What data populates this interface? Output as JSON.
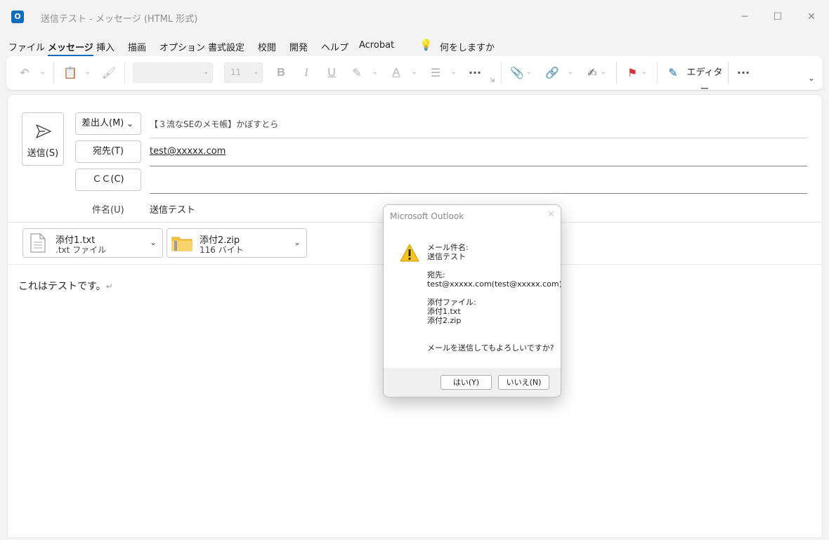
{
  "window": {
    "app_icon": "outlook-icon",
    "title": "送信テスト  -  メッセージ (HTML 形式)"
  },
  "menu": [
    "ファイル",
    "メッセージ",
    "挿入",
    "描画",
    "オプション",
    "書式設定",
    "校閲",
    "開発",
    "ヘルプ",
    "Acrobat"
  ],
  "menu_search": "何をしますか",
  "ribbon": {
    "font_size": "11",
    "bold": "B",
    "italic": "I",
    "underline": "U",
    "font_color": "A",
    "editor_label": "エディター"
  },
  "compose": {
    "send_label": "送信(S)",
    "from_button": "差出人(M)",
    "from_value": "【３流なSEのメモ帳】かぼすとら",
    "to_button": "宛先(T)",
    "to_value": "test@xxxxx.com",
    "cc_button": "ＣＣ(C)",
    "cc_value": "",
    "subject_label": "件名(U)",
    "subject_value": "送信テスト",
    "attachments": [
      {
        "name": "添付1.txt",
        "sub": ".txt ファイル"
      },
      {
        "name": "添付2.zip",
        "sub": "116 バイト"
      }
    ],
    "body": "これはテストです。",
    "para_mark": "↵"
  },
  "dialog": {
    "title": "Microsoft Outlook",
    "subject_label": "メール件名:",
    "subject_value": "送信テスト",
    "to_label": "宛先:",
    "to_value": "test@xxxxx.com(test@xxxxx.com)",
    "att_label": "添付ファイル:",
    "att_1": "添付1.txt",
    "att_2": "添付2.zip",
    "question": "メールを送信してもよろしいですか?",
    "yes_button": "はい(Y)",
    "no_button": "いいえ(N)"
  },
  "colors": {
    "accent": "#0f6cbd",
    "flag": "#d13438",
    "warning": "#f7c31c"
  }
}
